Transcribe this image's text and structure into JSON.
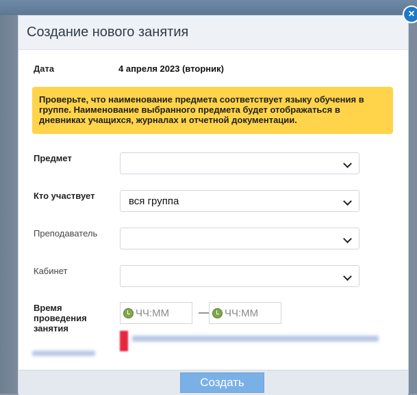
{
  "modal": {
    "title": "Создание нового занятия",
    "close_icon": "×"
  },
  "date": {
    "label": "Дата",
    "value": "4 апреля 2023 (вторник)"
  },
  "warning": {
    "text": "Проверьте, что наименование предмета соответствует языку обучения в группе. Наименование выбранного предмета будет отображаться в дневниках учащихся, журналах и отчетной документации.",
    "color": "#ffd44a"
  },
  "fields": {
    "subject": {
      "label": "Предмет",
      "value": ""
    },
    "participants": {
      "label": "Кто участвует",
      "value": "вся группа"
    },
    "teacher": {
      "label": "Преподаватель",
      "value": ""
    },
    "room": {
      "label": "Кабинет",
      "value": ""
    }
  },
  "time": {
    "label_line1": "Время",
    "label_line2": "проведения",
    "label_line3": "занятия",
    "start_placeholder": "ЧЧ:ММ",
    "separator": "—",
    "end_placeholder": "ЧЧ:ММ"
  },
  "footer": {
    "create_label": "Создать"
  },
  "colors": {
    "accent": "#7ab0e6",
    "close": "#1f78c8"
  }
}
